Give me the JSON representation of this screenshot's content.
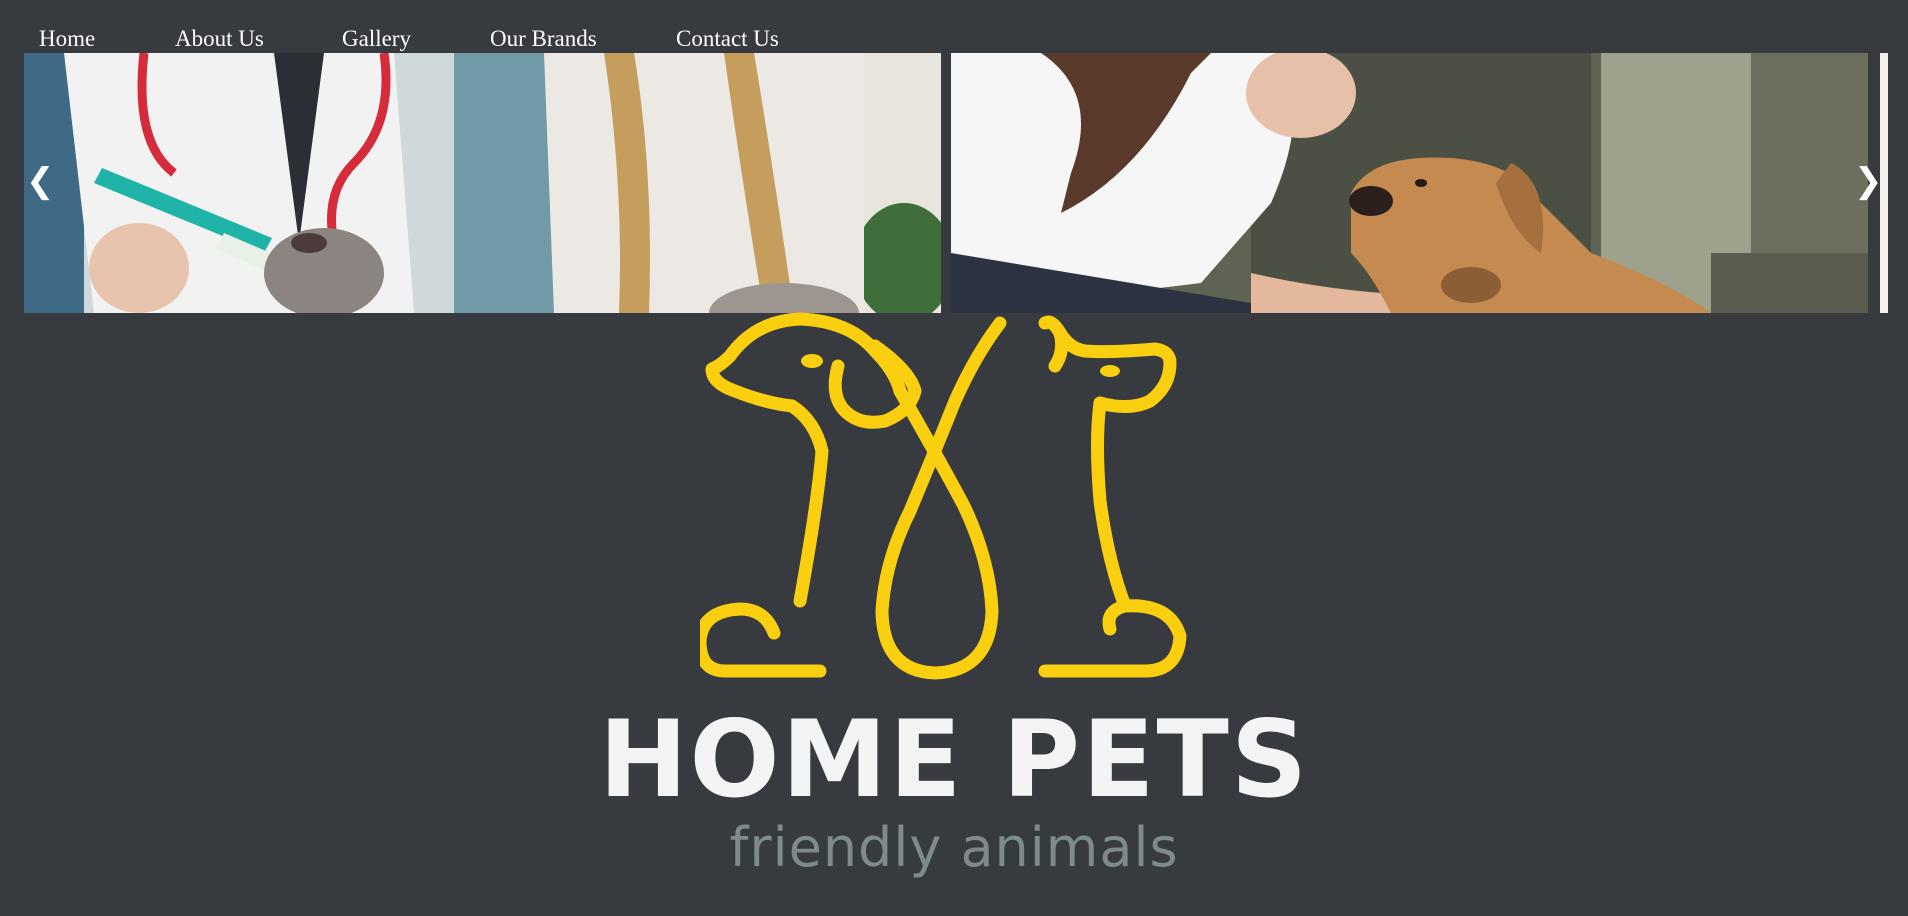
{
  "nav": {
    "items": [
      {
        "label": "Home"
      },
      {
        "label": "About Us"
      },
      {
        "label": "Gallery"
      },
      {
        "label": "Our Brands"
      },
      {
        "label": "Contact Us"
      }
    ]
  },
  "slider": {
    "prev_label": "❮",
    "next_label": "❯",
    "slides": [
      {
        "image": "vet-with-syringe-and-puppy-photo"
      },
      {
        "image": "woman-with-brown-dog-photo"
      }
    ]
  },
  "brand": {
    "name": "HOME PETS",
    "tagline": "friendly animals",
    "logo_color": "#f9cf10",
    "logo_icon": "dog-and-cat-silhouette-icon"
  },
  "colors": {
    "background": "#373a3f",
    "nav_text": "#ffffff",
    "title_text": "#f4f4f4",
    "tagline_text": "#7f8a8c"
  }
}
